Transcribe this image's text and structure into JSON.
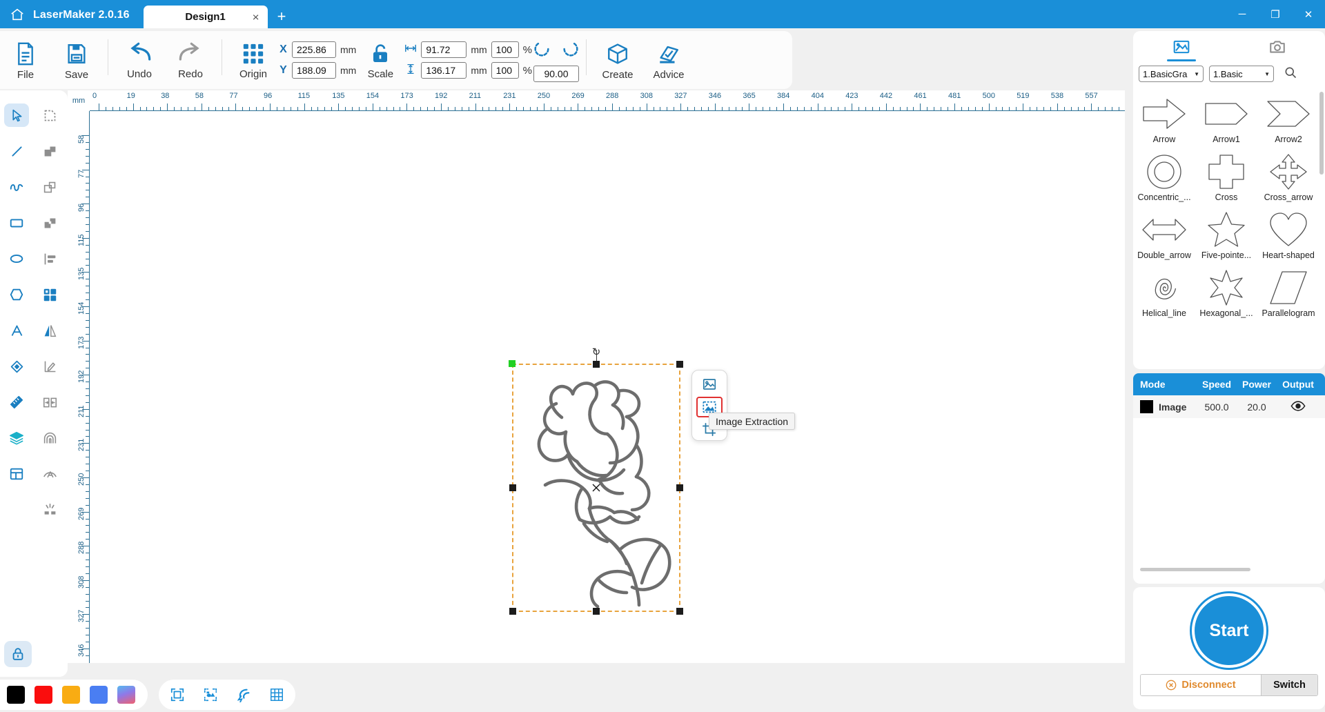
{
  "titlebar": {
    "home_icon": "home-icon",
    "app_title": "LaserMaker 2.0.16",
    "tab_label": "Design1",
    "tab_close": "×",
    "tab_add": "+",
    "minimize": "─",
    "maximize": "❐",
    "close": "✕"
  },
  "ribbon": {
    "file_label": "File",
    "save_label": "Save",
    "undo_label": "Undo",
    "redo_label": "Redo",
    "origin_label": "Origin",
    "scale_label": "Scale",
    "create_label": "Create",
    "advice_label": "Advice",
    "x_axis": "X",
    "y_axis": "Y",
    "x_value": "225.86",
    "y_value": "188.09",
    "x_unit": "mm",
    "y_unit": "mm",
    "width_value": "91.72",
    "height_value": "136.17",
    "width_unit": "mm",
    "height_unit": "mm",
    "width_percent": "100",
    "height_percent": "100",
    "percent_symbol": "%",
    "rotation_value": "90.00"
  },
  "left_toolbar": {
    "tools": [
      {
        "name": "select-tool",
        "selected": true
      },
      {
        "name": "node-edit-tool",
        "selected": false
      },
      {
        "name": "line-tool",
        "selected": false
      },
      {
        "name": "union-tool",
        "selected": false
      },
      {
        "name": "curve-tool",
        "selected": false
      },
      {
        "name": "subtract-tool",
        "selected": false
      },
      {
        "name": "rectangle-tool",
        "selected": false
      },
      {
        "name": "intersect-tool",
        "selected": false
      },
      {
        "name": "ellipse-tool",
        "selected": false
      },
      {
        "name": "align-tool",
        "selected": false
      },
      {
        "name": "polygon-tool",
        "selected": false
      },
      {
        "name": "array-tool",
        "selected": false
      },
      {
        "name": "text-tool",
        "selected": false
      },
      {
        "name": "mirror-tool",
        "selected": false
      },
      {
        "name": "eraser-tool",
        "selected": false
      },
      {
        "name": "measure-edit-tool",
        "selected": false
      },
      {
        "name": "ruler-tool",
        "selected": false
      },
      {
        "name": "distribute-tool",
        "selected": false
      },
      {
        "name": "layers-tool",
        "selected": false
      },
      {
        "name": "offset-tool",
        "selected": false
      },
      {
        "name": "layout-tool",
        "selected": false
      },
      {
        "name": "curve-text-tool",
        "selected": false
      },
      {
        "name": "spacer",
        "selected": false
      },
      {
        "name": "cut-tool",
        "selected": false
      }
    ],
    "lock_label": "lock-icon"
  },
  "rulers": {
    "unit_label": "mm",
    "horizontal_ticks": [
      0,
      19,
      38,
      58,
      77,
      96,
      115,
      135,
      154,
      173,
      192,
      211,
      231,
      250,
      269,
      288,
      308,
      327,
      346,
      365,
      384,
      404,
      423,
      442,
      461,
      481,
      500,
      519,
      538,
      557
    ],
    "vertical_ticks": [
      58,
      77,
      96,
      115,
      135,
      154,
      173,
      192,
      211,
      231,
      250,
      269,
      288,
      308,
      327,
      346
    ]
  },
  "canvas": {
    "object_name": "rose-line-art",
    "selection": {
      "border_color": "#e8a33d",
      "anchor_color": "#22d024",
      "handle_color": "#1c1c1c",
      "rotate_icon": "↻"
    },
    "popup": {
      "items": [
        "image-properties-icon",
        "image-extraction-icon",
        "crop-icon"
      ],
      "active_index": 1,
      "tooltip": "Image Extraction"
    }
  },
  "bottom_bar": {
    "colors": [
      {
        "name": "color-black",
        "hex": "#000000"
      },
      {
        "name": "color-red",
        "hex": "#fa0d0d"
      },
      {
        "name": "color-orange",
        "hex": "#f9ac13"
      },
      {
        "name": "color-blue",
        "hex": "#4a7ef2"
      },
      {
        "name": "color-gradient",
        "hex": "#56b9ef"
      }
    ],
    "tools": [
      {
        "name": "fit-frame-icon"
      },
      {
        "name": "select-objects-icon"
      },
      {
        "name": "magnet-snap-icon"
      },
      {
        "name": "grid-icon"
      }
    ]
  },
  "right_panel": {
    "tabs": [
      {
        "name": "library-tab",
        "icon": "image-library-icon",
        "active": true
      },
      {
        "name": "camera-tab",
        "icon": "camera-icon",
        "active": false
      }
    ],
    "category_select": "1.BasicGra",
    "subcategory_select": "1.Basic",
    "search_icon": "search-icon",
    "shapes": [
      {
        "name": "Arrow",
        "icon": "arrow-shape"
      },
      {
        "name": "Arrow1",
        "icon": "arrow1-shape"
      },
      {
        "name": "Arrow2",
        "icon": "arrow2-shape"
      },
      {
        "name": "Concentric_...",
        "icon": "concentric-circles-shape"
      },
      {
        "name": "Cross",
        "icon": "cross-shape"
      },
      {
        "name": "Cross_arrow",
        "icon": "cross-arrow-shape"
      },
      {
        "name": "Double_arrow",
        "icon": "double-arrow-shape"
      },
      {
        "name": "Five-pointe...",
        "icon": "five-pointed-star-shape"
      },
      {
        "name": "Heart-shaped",
        "icon": "heart-shape"
      },
      {
        "name": "Helical_line",
        "icon": "helical-line-shape"
      },
      {
        "name": "Hexagonal_...",
        "icon": "hexagonal-star-shape"
      },
      {
        "name": "Parallelogram",
        "icon": "parallelogram-shape"
      }
    ],
    "layer_table": {
      "headers": [
        "Mode",
        "Speed",
        "Power",
        "Output"
      ],
      "rows": [
        {
          "color": "#000000",
          "mode": "Image",
          "speed": "500.0",
          "power": "20.0",
          "output": "eye-icon"
        }
      ]
    },
    "start_label": "Start",
    "disconnect_label": "Disconnect",
    "switch_label": "Switch"
  }
}
